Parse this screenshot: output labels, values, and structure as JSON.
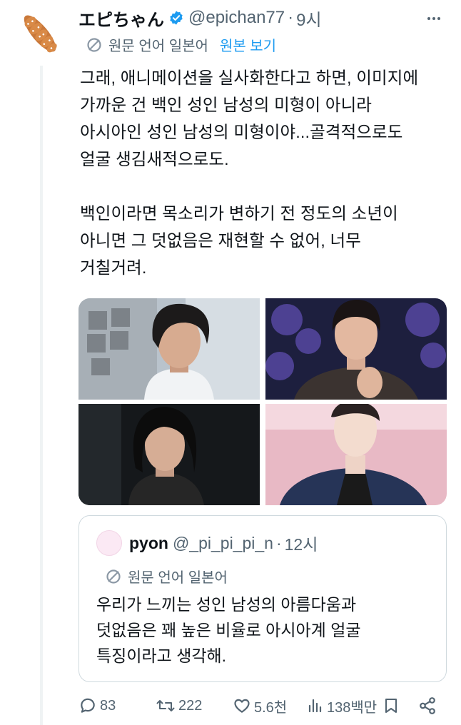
{
  "author": {
    "display_name": "エピちゃん",
    "handle": "@epichan77",
    "separator": "·",
    "time": "9시",
    "verified": true
  },
  "translate": {
    "source_label": "원문 언어 일본어",
    "show_original": "원본 보기"
  },
  "body": {
    "lines": [
      "그래, 애니메이션을 실사화한다고 하면, 이미지에",
      "가까운 건 백인 성인 남성의 미형이 아니라",
      "아시아인 성인 남성의 미형이야...골격적으로도",
      "얼굴 생김새적으로도.",
      "",
      "백인이라면 목소리가 변하기 전 정도의 소년이",
      "아니면 그 덧없음은 재현할 수 없어, 너무",
      "거칠거려."
    ]
  },
  "quote": {
    "display_name": "pyon",
    "handle": "@_pi_pi_pi_n",
    "separator": "·",
    "time": "12시",
    "translate_label": "원문 언어 일본어",
    "lines": [
      "우리가 느끼는 성인 남성의 아름다움과",
      "덧없음은 꽤 높은 비율로 아시아계 얼굴",
      "특징이라고 생각해."
    ]
  },
  "actions": {
    "replies": "83",
    "reposts": "222",
    "likes": "5.6천",
    "views": "138백만"
  },
  "colors": {
    "accent": "#1d9bf0",
    "muted": "#536471",
    "border": "#cfd9de"
  },
  "icons": [
    "more-icon",
    "verified-badge-icon",
    "translate-globe-icon",
    "reply-icon",
    "repost-icon",
    "like-icon",
    "views-icon",
    "bookmark-icon",
    "share-icon"
  ]
}
